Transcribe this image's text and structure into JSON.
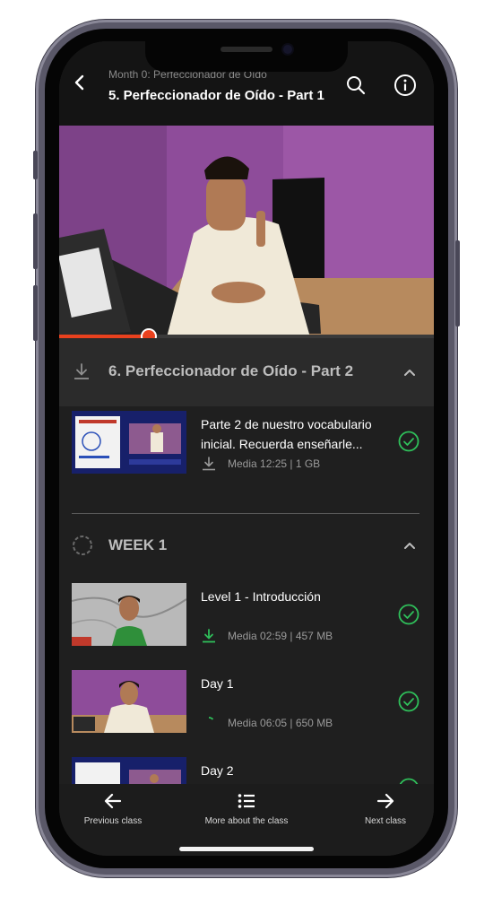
{
  "header": {
    "breadcrumb": "Month 0: Perfeccionador de Oído",
    "title": "5. Perfeccionador de Oído - Part 1"
  },
  "player": {
    "progress_percent": 24
  },
  "sections": [
    {
      "title": "6. Perfeccionador de Oído - Part 2",
      "lessons": [
        {
          "title": "Parte 2 de nuestro vocabulario inicial. Recuerda enseñarle...",
          "meta": "Media 12:25 | 1 GB",
          "completed": true,
          "download_state": "available"
        }
      ]
    },
    {
      "title": "WEEK 1",
      "lessons": [
        {
          "title": "Level 1 - Introducción",
          "meta": "Media 02:59 | 457 MB",
          "completed": true,
          "download_state": "downloaded"
        },
        {
          "title": "Day 1",
          "meta": "Media 06:05 | 650 MB",
          "completed": true,
          "download_state": "downloading"
        },
        {
          "title": "Day 2",
          "completed": true
        }
      ]
    }
  ],
  "bottom_nav": {
    "previous": "Previous class",
    "more": "More about the class",
    "next": "Next class"
  },
  "colors": {
    "accent_green": "#2fbf5a",
    "progress_red": "#e9411e",
    "background": "#1f1f1f"
  }
}
